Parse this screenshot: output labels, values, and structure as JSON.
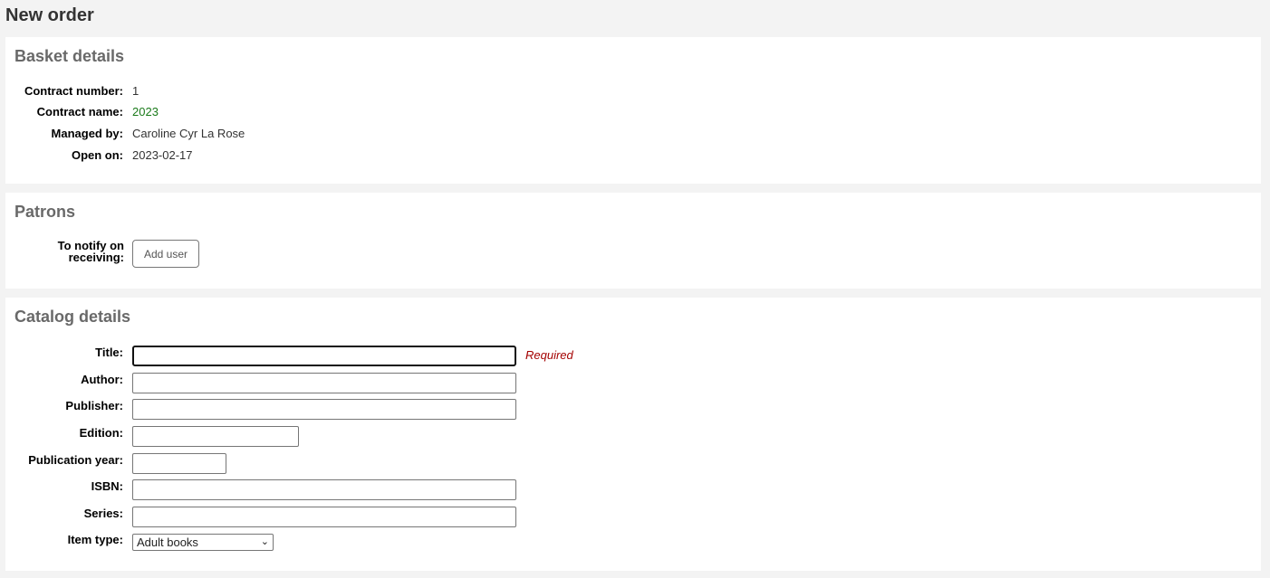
{
  "page_title": "New order",
  "basket": {
    "heading": "Basket details",
    "fields": [
      {
        "label": "Contract number:",
        "value": "1"
      },
      {
        "label": "Contract name:",
        "value": "2023"
      },
      {
        "label": "Managed by:",
        "value": "Caroline Cyr La Rose"
      },
      {
        "label": "Open on:",
        "value": "2023-02-17"
      }
    ]
  },
  "patrons": {
    "heading": "Patrons",
    "notify_label_line1": "To notify on",
    "notify_label_line2": "receiving:",
    "add_user_label": "Add user"
  },
  "catalog": {
    "heading": "Catalog details",
    "title_label": "Title:",
    "title_value": "",
    "required_text": "Required",
    "author_label": "Author:",
    "author_value": "",
    "publisher_label": "Publisher:",
    "publisher_value": "",
    "edition_label": "Edition:",
    "edition_value": "",
    "pubyear_label": "Publication year:",
    "pubyear_value": "",
    "isbn_label": "ISBN:",
    "isbn_value": "",
    "series_label": "Series:",
    "series_value": "",
    "itemtype_label": "Item type:",
    "itemtype_value": "Adult books"
  },
  "colors": {
    "link_green": "#1a7a1a",
    "required_red": "#a40000"
  }
}
